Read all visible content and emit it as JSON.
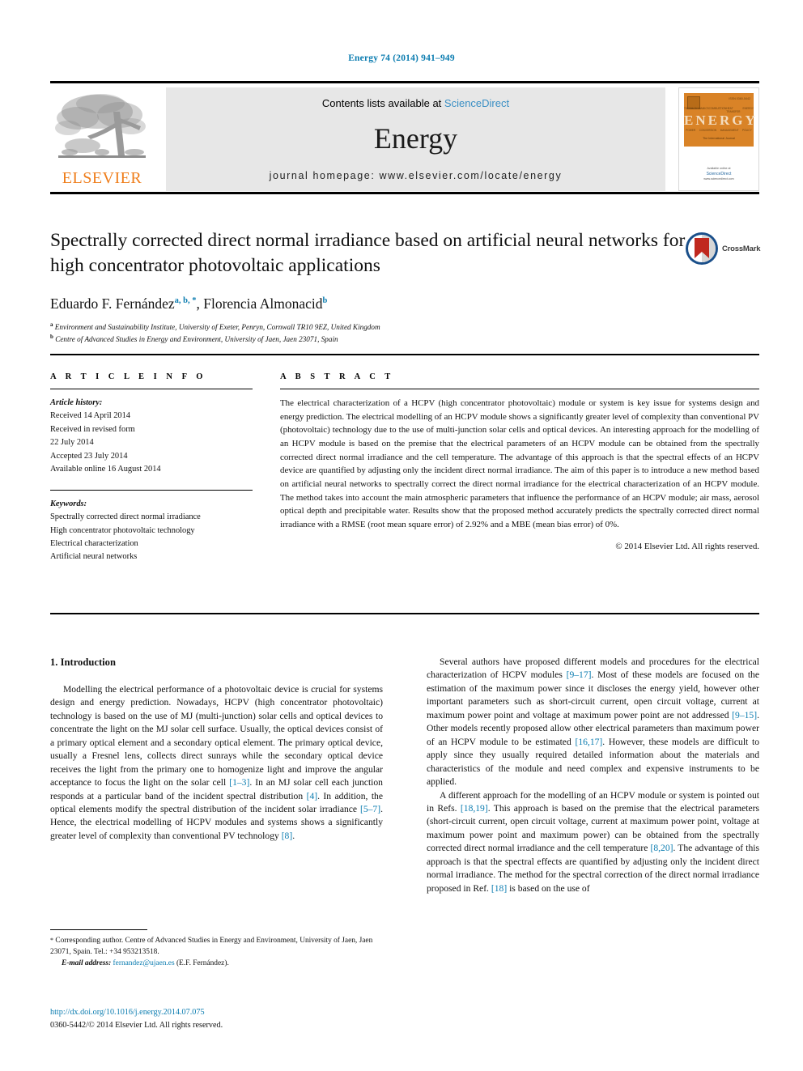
{
  "running_head": "Energy 74 (2014) 941–949",
  "masthead": {
    "publisher": "ELSEVIER",
    "contents_prefix": "Contents lists available at ",
    "contents_link": "ScienceDirect",
    "journal_name": "Energy",
    "homepage": "journal homepage: www.elsevier.com/locate/energy",
    "cover": {
      "title": "ENERGY",
      "top_right_note": "ISSN 0360-5442",
      "columns_top": [
        "THERMODYNAMICS",
        "COMBUSTION",
        "HEAT TRANSFER",
        "ENERGY"
      ],
      "columns_bottom": [
        "POWER",
        "CONVERSION",
        "MANAGEMENT",
        "POLICY"
      ],
      "subtitle": "The International Journal",
      "footer_line1": "Available online at",
      "footer_line2": "ScienceDirect",
      "footer_line3": "www.sciencedirect.com"
    }
  },
  "article": {
    "title": "Spectrally corrected direct normal irradiance based on artificial neural networks for high concentrator photovoltaic applications",
    "crossmark_label": "CrossMark",
    "authors": [
      {
        "name": "Eduardo F. Fernández",
        "marks": "a, b, *"
      },
      {
        "name": "Florencia Almonacid",
        "marks": "b"
      }
    ],
    "affiliations": [
      {
        "mark": "a",
        "text": "Environment and Sustainability Institute, University of Exeter, Penryn, Cornwall TR10 9EZ, United Kingdom"
      },
      {
        "mark": "b",
        "text": "Centre of Advanced Studies in Energy and Environment, University of Jaen, Jaen 23071, Spain"
      }
    ]
  },
  "article_info": {
    "heading": "A R T I C L E  I N F O",
    "history_label": "Article history:",
    "history": [
      "Received 14 April 2014",
      "Received in revised form",
      "22 July 2014",
      "Accepted 23 July 2014",
      "Available online 16 August 2014"
    ],
    "keywords_label": "Keywords:",
    "keywords": [
      "Spectrally corrected direct normal irradiance",
      "High concentrator photovoltaic technology",
      "Electrical characterization",
      "Artificial neural networks"
    ]
  },
  "abstract": {
    "heading": "A B S T R A C T",
    "text": "The electrical characterization of a HCPV (high concentrator photovoltaic) module or system is key issue for systems design and energy prediction. The electrical modelling of an HCPV module shows a significantly greater level of complexity than conventional PV (photovoltaic) technology due to the use of multi-junction solar cells and optical devices. An interesting approach for the modelling of an HCPV module is based on the premise that the electrical parameters of an HCPV module can be obtained from the spectrally corrected direct normal irradiance and the cell temperature. The advantage of this approach is that the spectral effects of an HCPV device are quantified by adjusting only the incident direct normal irradiance. The aim of this paper is to introduce a new method based on artificial neural networks to spectrally correct the direct normal irradiance for the electrical characterization of an HCPV module. The method takes into account the main atmospheric parameters that influence the performance of an HCPV module; air mass, aerosol optical depth and precipitable water. Results show that the proposed method accurately predicts the spectrally corrected direct normal irradiance with a RMSE (root mean square error) of 2.92% and a MBE (mean bias error) of 0%.",
    "copyright": "© 2014 Elsevier Ltd. All rights reserved."
  },
  "body": {
    "section_heading": "1. Introduction",
    "left_paragraph_part1": "Modelling the electrical performance of a photovoltaic device is crucial for systems design and energy prediction. Nowadays, HCPV (high concentrator photovoltaic) technology is based on the use of MJ (multi-junction) solar cells and optical devices to concentrate the light on the MJ solar cell surface. Usually, the optical devices consist of a primary optical element and a secondary optical element. The primary optical device, usually a Fresnel lens, collects direct sunrays while the secondary optical device receives the light from the primary one to homogenize light and improve the angular acceptance to focus the light on the solar cell ",
    "ref_1_3": "[1–3]",
    "left_paragraph_part2": ". In an MJ solar cell each junction responds at a particular band of the incident spectral distribution ",
    "ref_4": "[4]",
    "left_paragraph_part3": ". In addition, the optical elements modify the spectral distribution of the incident solar irradiance ",
    "ref_5_7": "[5–7]",
    "left_paragraph_part4": ". Hence, the electrical modelling of HCPV modules and systems shows a significantly greater level of complexity than conventional PV technology ",
    "ref_8": "[8]",
    "left_paragraph_part5": ".",
    "right_p1_part1": "Several authors have proposed different models and procedures for the electrical characterization of HCPV modules ",
    "ref_9_17": "[9–17]",
    "right_p1_part2": ". Most of these models are focused on the estimation of the maximum power since it discloses the energy yield, however other important parameters such as short-circuit current, open circuit voltage, current at maximum power point and voltage at maximum power point are not addressed ",
    "ref_9_15": "[9–15]",
    "right_p1_part3": ". Other models recently proposed allow other electrical parameters than maximum power of an HCPV module to be estimated ",
    "ref_16_17": "[16,17]",
    "right_p1_part4": ". However, these models are difficult to apply since they usually required detailed information about the materials and characteristics of the module and need complex and expensive instruments to be applied.",
    "right_p2_part1": "A different approach for the modelling of an HCPV module or system is pointed out in Refs. ",
    "ref_18_19": "[18,19]",
    "right_p2_part2": ". This approach is based on the premise that the electrical parameters (short-circuit current, open circuit voltage, current at maximum power point, voltage at maximum power point and maximum power) can be obtained from the spectrally corrected direct normal irradiance and the cell temperature ",
    "ref_8_20": "[8,20]",
    "right_p2_part3": ". The advantage of this approach is that the spectral effects are quantified by adjusting only the incident direct normal irradiance. The method for the spectral correction of the direct normal irradiance proposed in Ref. ",
    "ref_18": "[18]",
    "right_p2_part4": " is based on the use of"
  },
  "footnote": {
    "star": "*",
    "corresponding": " Corresponding author. Centre of Advanced Studies in Energy and Environment, University of Jaen, Jaen 23071, Spain. Tel.: +34 953213518.",
    "email_label": "E-mail address:",
    "email": "fernandez@ujaen.es",
    "email_suffix": " (E.F. Fernández)."
  },
  "imprint": {
    "doi": "http://dx.doi.org/10.1016/j.energy.2014.07.075",
    "issn_line": "0360-5442/© 2014 Elsevier Ltd. All rights reserved."
  }
}
